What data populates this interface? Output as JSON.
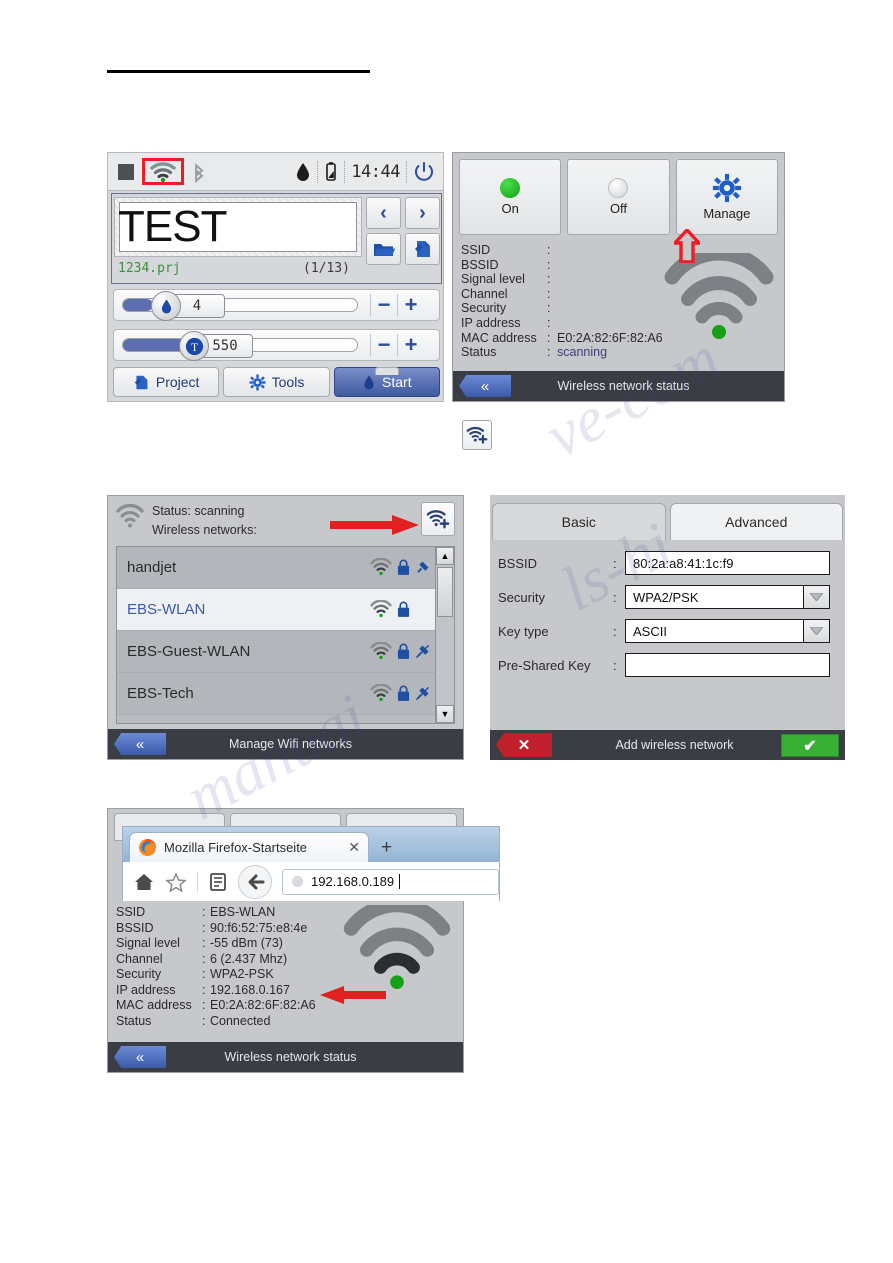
{
  "panel1": {
    "statusbar": {
      "time": "14:44",
      "icons": [
        "square-icon",
        "wifi-icon",
        "bluetooth-icon",
        "ink-drop-icon",
        "battery-icon",
        "power-icon"
      ]
    },
    "message_text": "TEST",
    "project_file": "1234.prj",
    "page_counter": "(1/13)",
    "nav_prev": "‹",
    "nav_next": "›",
    "slider1": {
      "value": "4",
      "icon": "ink-drop-icon",
      "minus": "−",
      "plus": "+",
      "fill_percent": 13
    },
    "slider2": {
      "value": "550",
      "icon": "resolution-icon",
      "minus": "−",
      "plus": "+",
      "fill_percent": 29
    },
    "buttons": {
      "project": "Project",
      "tools": "Tools",
      "start": "Start"
    }
  },
  "panel2": {
    "on_label": "On",
    "off_label": "Off",
    "manage_label": "Manage",
    "info": [
      {
        "key": "SSID",
        "value": ""
      },
      {
        "key": "BSSID",
        "value": ""
      },
      {
        "key": "Signal level",
        "value": ""
      },
      {
        "key": "Channel",
        "value": ""
      },
      {
        "key": "Security",
        "value": ""
      },
      {
        "key": "IP address",
        "value": ""
      },
      {
        "key": "MAC address",
        "value": "E0:2A:82:6F:82:A6",
        "nocolon": true
      },
      {
        "key": "Status",
        "value": "scanning",
        "highlight": true
      }
    ],
    "footer_title": "Wireless network status",
    "back_label": "«"
  },
  "middle_icon": {
    "name": "add-wifi-icon"
  },
  "panel3": {
    "status_line": "Status: scanning",
    "networks_label": "Wireless networks:",
    "add_button": "add-wifi-icon",
    "networks": [
      {
        "ssid": "handjet",
        "selected": false,
        "locked": true,
        "connected": true
      },
      {
        "ssid": "EBS-WLAN",
        "selected": true,
        "locked": true,
        "connected": false
      },
      {
        "ssid": "EBS-Guest-WLAN",
        "selected": false,
        "locked": true,
        "connected": false
      },
      {
        "ssid": "EBS-Tech",
        "selected": false,
        "locked": true,
        "connected": false
      }
    ],
    "footer_title": "Manage Wifi networks",
    "back_label": "«"
  },
  "panel4": {
    "tabs": [
      {
        "label": "Basic",
        "active": true
      },
      {
        "label": "Advanced",
        "active": false
      }
    ],
    "fields": [
      {
        "label": "BSSID",
        "colon": ":",
        "value": "80:2a:a8:41:1c:f9",
        "type": "input"
      },
      {
        "label": "Security",
        "colon": ":",
        "value": "WPA2/PSK",
        "type": "select"
      },
      {
        "label": "Key type",
        "colon": ":",
        "value": "ASCII",
        "type": "select"
      },
      {
        "label": "Pre-Shared Key",
        "colon": ":",
        "value": "",
        "type": "input"
      }
    ],
    "footer_title": "Add wireless network",
    "cancel_label": "✕",
    "confirm_label": "✔"
  },
  "panel5": {
    "firefox": {
      "tab_title": "Mozilla Firefox-Startseite",
      "close_label": "✕",
      "new_tab_label": "+",
      "url": "192.168.0.189",
      "icons": [
        "home-icon",
        "star-icon",
        "bookmarks-icon",
        "back-arrow-icon",
        "globe-icon"
      ]
    },
    "info": [
      {
        "key": "SSID",
        "value": "EBS-WLAN"
      },
      {
        "key": "BSSID",
        "value": "90:f6:52:75:e8:4e"
      },
      {
        "key": "Signal level",
        "value": "-55 dBm (73)"
      },
      {
        "key": "Channel",
        "value": "6 (2.437 Mhz)"
      },
      {
        "key": "Security",
        "value": "WPA2-PSK"
      },
      {
        "key": "IP address",
        "value": "192.168.0.167"
      },
      {
        "key": "MAC address",
        "value": "E0:2A:82:6F:82:A6",
        "nocolon": true
      },
      {
        "key": "Status",
        "value": "Connected"
      }
    ],
    "footer_title": "Wireless network status",
    "back_label": "«"
  },
  "watermark": "manualshive.com",
  "colors": {
    "accent_blue": "#2a4d9e",
    "red_arrow": "#ee1c24",
    "green_ok": "#38b033",
    "red_cancel": "#c0202b",
    "status_green": "#15a015"
  }
}
